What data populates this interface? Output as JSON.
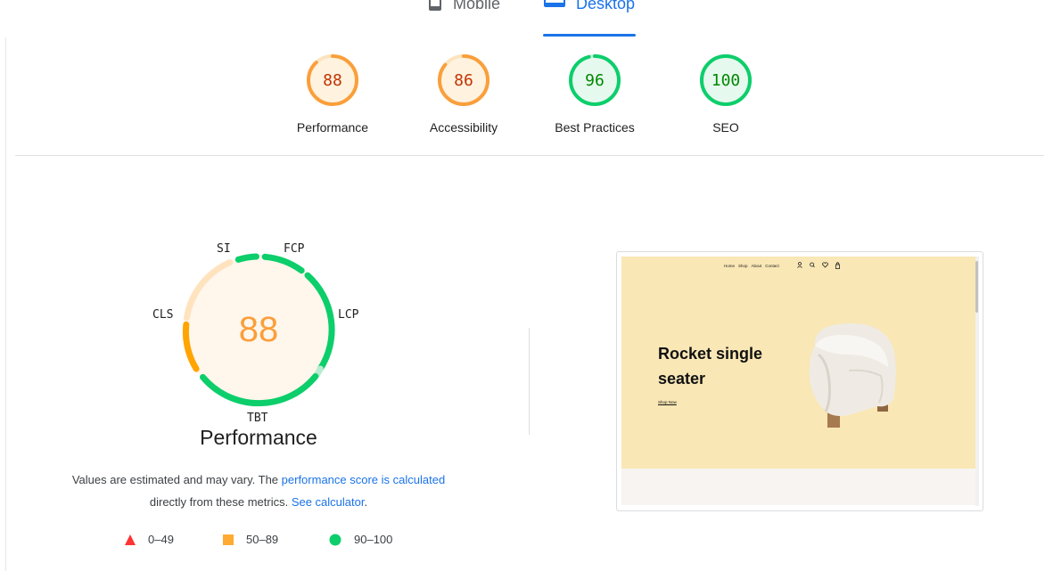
{
  "device_tabs": [
    {
      "label": "Mobile",
      "icon": "mobile-icon",
      "active": false
    },
    {
      "label": "Desktop",
      "icon": "desktop-icon",
      "active": true
    }
  ],
  "categories": [
    {
      "label": "Performance",
      "score": 88,
      "color": "#fa9f3b",
      "fill": "#fff3e0",
      "text_color": "#c33300"
    },
    {
      "label": "Accessibility",
      "score": 86,
      "color": "#fa9f3b",
      "fill": "#fff3e0",
      "text_color": "#c33300"
    },
    {
      "label": "Best Practices",
      "score": 96,
      "color": "#0cce6b",
      "fill": "#e6f9ef",
      "text_color": "#008800"
    },
    {
      "label": "SEO",
      "score": 100,
      "color": "#0cce6b",
      "fill": "#e6f9ef",
      "text_color": "#008800"
    }
  ],
  "performance": {
    "score": "88",
    "title": "Performance",
    "metrics": {
      "si": "SI",
      "fcp": "FCP",
      "lcp": "LCP",
      "tbt": "TBT",
      "cls": "CLS"
    }
  },
  "description": {
    "prefix": "Values are estimated and may vary. The ",
    "link1": "performance score is calculated",
    "middle": "directly from these metrics. ",
    "link2": "See calculator",
    "suffix": "."
  },
  "legend": [
    {
      "icon": "red-triangle-icon",
      "range": "0–49",
      "color": "#ff3333"
    },
    {
      "icon": "orange-square-icon",
      "range": "50–89",
      "color": "#ffaa33"
    },
    {
      "icon": "green-circle-icon",
      "range": "90–100",
      "color": "#0cce6b"
    }
  ],
  "preview": {
    "nav": [
      "Home",
      "Shop",
      "About",
      "Contact"
    ],
    "hero_title": "Rocket single seater",
    "shop_link": "Shop Now",
    "hero_bg": "#f9e7b5"
  }
}
